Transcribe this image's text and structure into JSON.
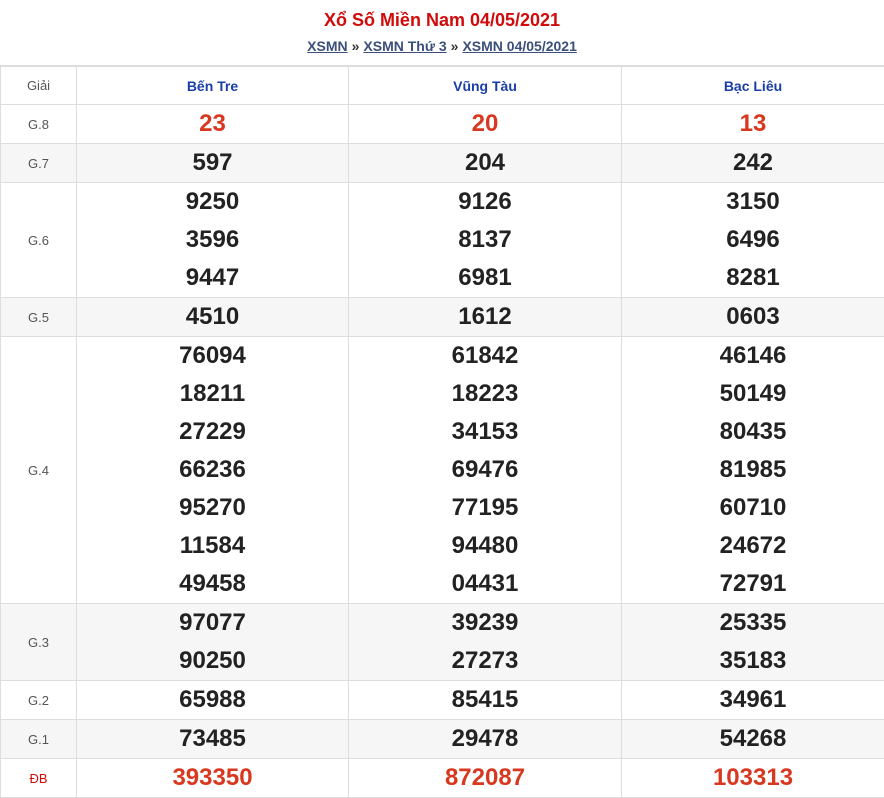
{
  "header": {
    "title": "Xổ Số Miền Nam 04/05/2021",
    "breadcrumb": [
      "XSMN",
      "XSMN Thứ 3",
      "XSMN 04/05/2021"
    ],
    "separator": "»"
  },
  "table": {
    "label_header": "Giải",
    "provinces": [
      "Bến Tre",
      "Vũng Tàu",
      "Bạc Liêu"
    ],
    "rows": [
      {
        "label": "G.8",
        "values": [
          [
            "23"
          ],
          [
            "20"
          ],
          [
            "13"
          ]
        ]
      },
      {
        "label": "G.7",
        "values": [
          [
            "597"
          ],
          [
            "204"
          ],
          [
            "242"
          ]
        ]
      },
      {
        "label": "G.6",
        "values": [
          [
            "9250",
            "3596",
            "9447"
          ],
          [
            "9126",
            "8137",
            "6981"
          ],
          [
            "3150",
            "6496",
            "8281"
          ]
        ]
      },
      {
        "label": "G.5",
        "values": [
          [
            "4510"
          ],
          [
            "1612"
          ],
          [
            "0603"
          ]
        ]
      },
      {
        "label": "G.4",
        "values": [
          [
            "76094",
            "18211",
            "27229",
            "66236",
            "95270",
            "11584",
            "49458"
          ],
          [
            "61842",
            "18223",
            "34153",
            "69476",
            "77195",
            "94480",
            "04431"
          ],
          [
            "46146",
            "50149",
            "80435",
            "81985",
            "60710",
            "24672",
            "72791"
          ]
        ]
      },
      {
        "label": "G.3",
        "values": [
          [
            "97077",
            "90250"
          ],
          [
            "39239",
            "27273"
          ],
          [
            "25335",
            "35183"
          ]
        ]
      },
      {
        "label": "G.2",
        "values": [
          [
            "65988"
          ],
          [
            "85415"
          ],
          [
            "34961"
          ]
        ]
      },
      {
        "label": "G.1",
        "values": [
          [
            "73485"
          ],
          [
            "29478"
          ],
          [
            "54268"
          ]
        ]
      },
      {
        "label": "ĐB",
        "values": [
          [
            "393350"
          ],
          [
            "872087"
          ],
          [
            "103313"
          ]
        ]
      }
    ]
  },
  "colors": {
    "title": "#d10a0a",
    "province": "#1a3ea8",
    "highlight_number": "#d8381f",
    "link": "#3a4f7a"
  }
}
